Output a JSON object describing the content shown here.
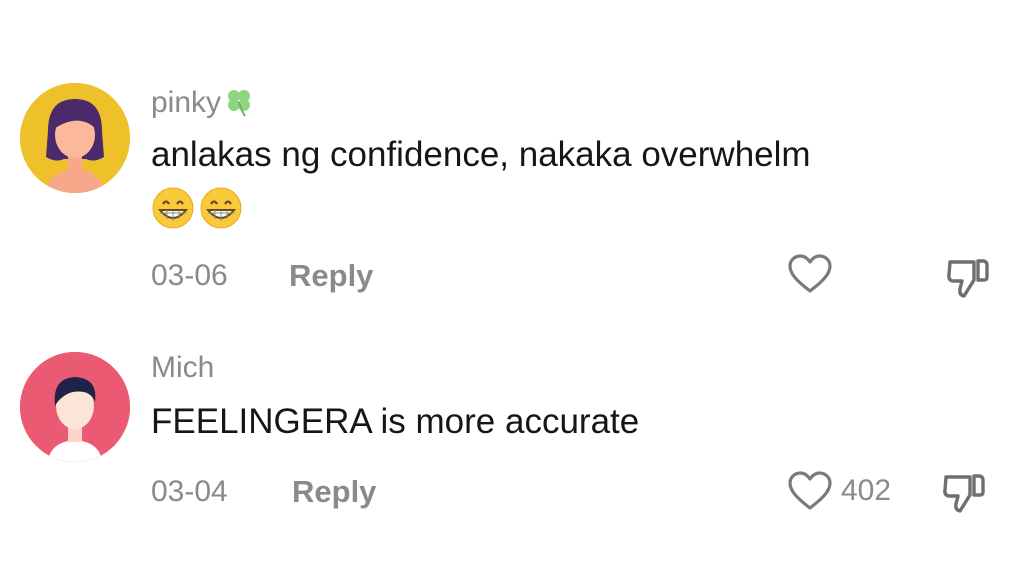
{
  "comments": [
    {
      "username": "pinky",
      "username_emoji": "four-leaf-clover",
      "text": "anlakas ng confidence, nakaka overwhelm",
      "emojis": [
        "grinning-face",
        "grinning-face"
      ],
      "date": "03-06",
      "reply_label": "Reply",
      "like_count": "",
      "avatar_bg": "#eec12a"
    },
    {
      "username": "Mich",
      "text": "FEELINGERA is more accurate",
      "date": "03-04",
      "reply_label": "Reply",
      "like_count": "402",
      "avatar_bg": "#ea5a72"
    }
  ],
  "colors": {
    "text": "#161616",
    "muted": "#8a8a8a",
    "background": "#ffffff"
  }
}
